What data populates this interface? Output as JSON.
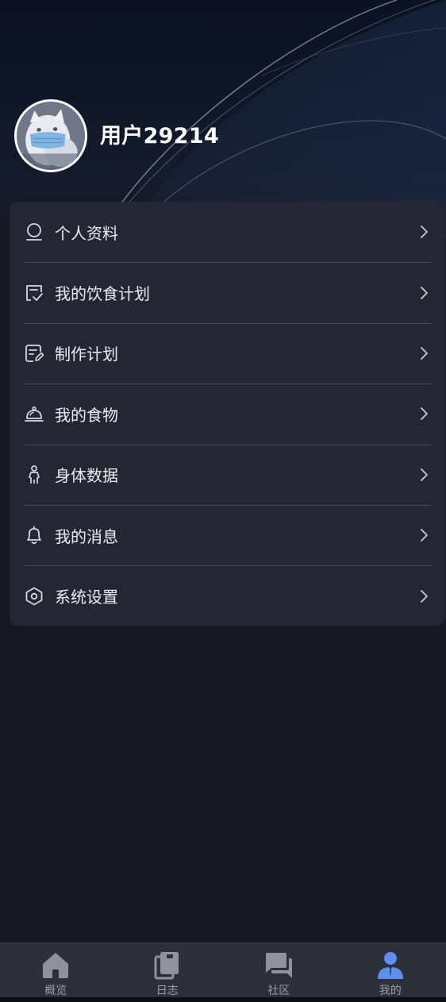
{
  "profile": {
    "username": "用户29214",
    "avatar_icon": "cat-with-mask-avatar"
  },
  "menu": {
    "items": [
      {
        "label": "个人资料",
        "icon": "user-icon"
      },
      {
        "label": "我的饮食计划",
        "icon": "checklist-icon"
      },
      {
        "label": "制作计划",
        "icon": "edit-plan-icon"
      },
      {
        "label": "我的食物",
        "icon": "food-cloche-icon"
      },
      {
        "label": "身体数据",
        "icon": "person-icon"
      },
      {
        "label": "我的消息",
        "icon": "bell-icon"
      },
      {
        "label": "系统设置",
        "icon": "settings-hexagon-icon"
      }
    ]
  },
  "tabbar": {
    "tabs": [
      {
        "label": "概览",
        "icon": "home-icon",
        "active": false
      },
      {
        "label": "日志",
        "icon": "journal-icon",
        "active": false
      },
      {
        "label": "社区",
        "icon": "chat-icon",
        "active": false
      },
      {
        "label": "我的",
        "icon": "profile-icon",
        "active": true
      }
    ],
    "active_color": "#5b8ff0",
    "inactive_color": "#8f929b"
  },
  "colors": {
    "background": "#161822",
    "card": "#242733",
    "divider": "#44485a"
  }
}
